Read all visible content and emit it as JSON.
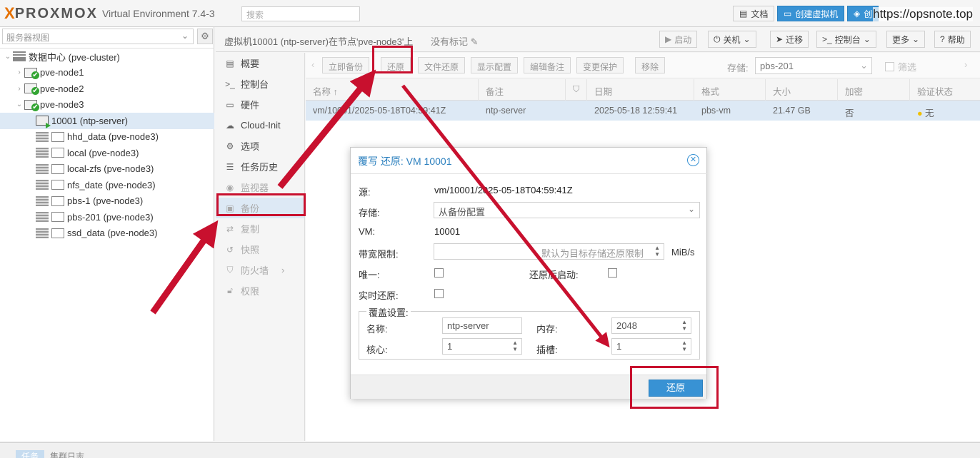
{
  "header": {
    "logo_mark": "X",
    "logo_text": "PROXMOX",
    "version": "Virtual Environment 7.4-3",
    "search_placeholder": "搜索",
    "docs_label": "文档",
    "create_vm_label": "创建虚拟机",
    "create_ct_label": "创",
    "watermark": "https://opsnote.top"
  },
  "tree": {
    "view_label": "服务器视图",
    "items": [
      {
        "label": "数据中心 (pve-cluster)",
        "icon": "datacenter-icon"
      },
      {
        "label": "pve-node1",
        "icon": "node-icon"
      },
      {
        "label": "pve-node2",
        "icon": "node-icon"
      },
      {
        "label": "pve-node3",
        "icon": "node-icon"
      },
      {
        "label": "10001 (ntp-server)",
        "icon": "vm-running-icon"
      },
      {
        "label": "hhd_data (pve-node3)",
        "icon": "storage-icon"
      },
      {
        "label": "local (pve-node3)",
        "icon": "storage-icon"
      },
      {
        "label": "local-zfs (pve-node3)",
        "icon": "storage-icon"
      },
      {
        "label": "nfs_date (pve-node3)",
        "icon": "storage-icon"
      },
      {
        "label": "pbs-1 (pve-node3)",
        "icon": "storage-icon"
      },
      {
        "label": "pbs-201 (pve-node3)",
        "icon": "storage-icon"
      },
      {
        "label": "ssd_data (pve-node3)",
        "icon": "storage-icon"
      }
    ]
  },
  "main_header": {
    "title": "虚拟机10001 (ntp-server)在节点'pve-node3'上",
    "no_tag": "没有标记",
    "start": "启动",
    "shutdown": "关机",
    "migrate": "迁移",
    "console": "控制台",
    "more": "更多",
    "help": "帮助"
  },
  "menu": {
    "items": [
      {
        "label": "概要",
        "icon": "book-icon"
      },
      {
        "label": "控制台",
        "icon": "terminal-icon"
      },
      {
        "label": "硬件",
        "icon": "monitor-icon"
      },
      {
        "label": "Cloud-Init",
        "icon": "cloud-icon"
      },
      {
        "label": "选项",
        "icon": "gear-icon"
      },
      {
        "label": "任务历史",
        "icon": "list-icon"
      },
      {
        "label": "监视器",
        "icon": "eye-icon"
      },
      {
        "label": "备份",
        "icon": "floppy-icon"
      },
      {
        "label": "复制",
        "icon": "retweet-icon"
      },
      {
        "label": "快照",
        "icon": "history-icon"
      },
      {
        "label": "防火墙",
        "icon": "shield-icon"
      },
      {
        "label": "权限",
        "icon": "unlock-icon"
      }
    ]
  },
  "toolbar": {
    "backup_now": "立即备份",
    "restore": "还原",
    "file_restore": "文件还原",
    "show_config": "显示配置",
    "edit_notes": "编辑备注",
    "change_protection": "变更保护",
    "remove": "移除",
    "storage_label": "存储:",
    "storage_value": "pbs-201",
    "filter_label": "筛选"
  },
  "grid": {
    "columns": [
      "名称 ↑",
      "备注",
      "",
      "日期",
      "格式",
      "大小",
      "加密",
      "验证状态"
    ],
    "row": {
      "name": "vm/10001/2025-05-18T04:59:41Z",
      "notes": "ntp-server",
      "date": "2025-05-18 12:59:41",
      "format": "pbs-vm",
      "size": "21.47 GB",
      "encrypted": "否",
      "verify": "无"
    }
  },
  "dialog": {
    "title": "覆写 还原: VM 10001",
    "source_label": "源:",
    "source_value": "vm/10001/2025-05-18T04:59:41Z",
    "storage_label": "存储:",
    "storage_value": "从备份配置",
    "vm_label": "VM:",
    "vm_value": "10001",
    "bw_label": "带宽限制:",
    "bw_placeholder": "默认为目标存储还原限制",
    "bw_unit": "MiB/s",
    "unique_label": "唯一:",
    "start_after_label": "还原后启动:",
    "live_restore_label": "实时还原:",
    "override_legend": "覆盖设置:",
    "name_label": "名称:",
    "name_value": "ntp-server",
    "memory_label": "内存:",
    "memory_value": "2048",
    "cores_label": "核心:",
    "cores_value": "1",
    "sockets_label": "插槽:",
    "sockets_value": "1",
    "restore_button": "还原"
  },
  "bottom": {
    "tasks_tab": "任务",
    "cluster_log_tab": "集群日志"
  },
  "colors": {
    "accent": "#3892d4",
    "annotation_red": "#c8102e",
    "selection": "#dde9f5",
    "brand_orange": "#e57000"
  }
}
